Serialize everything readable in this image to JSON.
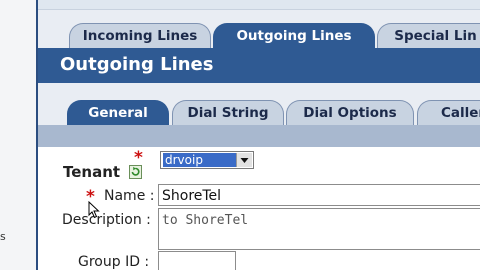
{
  "left_panel": {
    "clip_text": "s"
  },
  "top_tabs": [
    {
      "label": "Incoming Lines",
      "active": false
    },
    {
      "label": "Outgoing Lines",
      "active": true
    },
    {
      "label": "Special Lin",
      "active": false
    }
  ],
  "page_title": "Outgoing Lines",
  "sub_tabs": [
    {
      "label": "General",
      "active": true
    },
    {
      "label": "Dial String",
      "active": false
    },
    {
      "label": "Dial Options",
      "active": false
    },
    {
      "label": "Caller",
      "active": false
    }
  ],
  "form": {
    "tenant": {
      "label": "Tenant",
      "required_mark": "*",
      "value": "drvoip",
      "refresh_icon": "refresh-icon"
    },
    "name": {
      "label": "Name :",
      "required_mark": "*",
      "value": "ShoreTel"
    },
    "description": {
      "label": "Description :",
      "value": "to ShoreTel"
    },
    "group_id": {
      "label": "Group ID :",
      "value": ""
    }
  },
  "colors": {
    "accent": "#2f5a93",
    "required": "#cc1111",
    "tab_inactive": "#c8d3e1"
  }
}
